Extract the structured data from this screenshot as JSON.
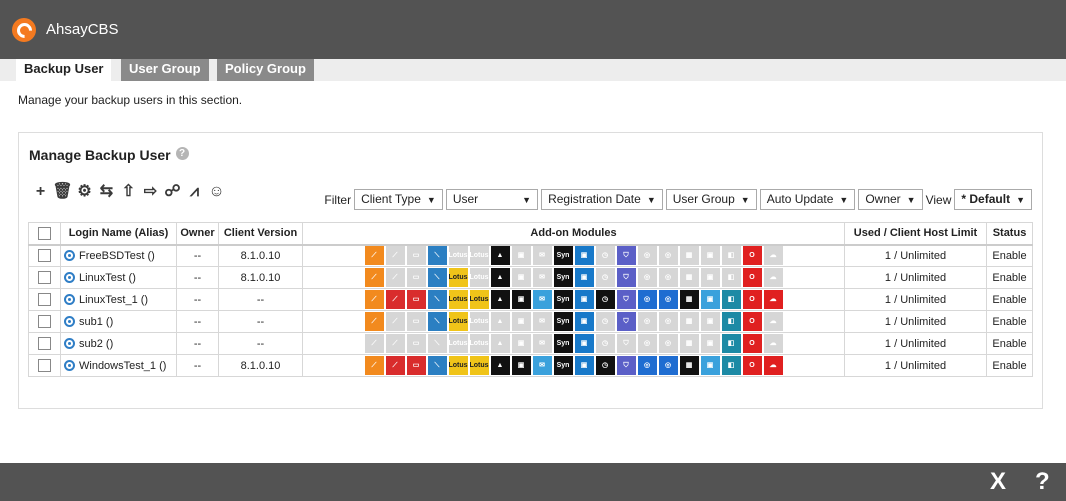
{
  "app": {
    "title": "AhsayCBS",
    "logo": "ahsay-c-logo"
  },
  "tabs": [
    {
      "label": "Backup User",
      "active": true
    },
    {
      "label": "User Group",
      "active": false
    },
    {
      "label": "Policy Group",
      "active": false
    }
  ],
  "description": "Manage your backup users in this section.",
  "panel": {
    "title": "Manage Backup User",
    "help": "?"
  },
  "toolbar": [
    {
      "icon": "add-icon",
      "glyph": "+"
    },
    {
      "icon": "delete-icon",
      "glyph": "🗑"
    },
    {
      "icon": "user-settings-icon",
      "glyph": "⚙"
    },
    {
      "icon": "merge-icon",
      "glyph": "⇆"
    },
    {
      "icon": "upload-icon",
      "glyph": "⇧"
    },
    {
      "icon": "export-icon",
      "glyph": "⇨"
    },
    {
      "icon": "user-move-icon",
      "glyph": "☍"
    },
    {
      "icon": "chart-icon",
      "glyph": "⩘"
    },
    {
      "icon": "user-search-icon",
      "glyph": "☺"
    }
  ],
  "filters": {
    "label": "Filter",
    "selects": [
      "Client Type",
      "User",
      "Registration Date",
      "User Group",
      "Auto Update",
      "Owner"
    ],
    "view_label": "View",
    "view_value": "* Default"
  },
  "columns": [
    "Login Name (Alias)",
    "Owner",
    "Client Version",
    "Add-on Modules",
    "Used / Client Host Limit",
    "Status"
  ],
  "module_icons": [
    "continuous-backup-icon",
    "cdp-icon",
    "oracle-icon",
    "mssql-icon",
    "lotus-domino-icon",
    "lotus-notes-icon",
    "google-drive-icon",
    "volume-shadow-icon",
    "exchange-mail-icon",
    "synology-nas-icon",
    "qnap-nas-icon",
    "schedule-icon",
    "shield-icon",
    "hyperv-icon",
    "vmware-icon",
    "windows-icon",
    "sharepoint-icon",
    "office365-icon",
    "office-icon",
    "cloud-icon"
  ],
  "module_colors": [
    "#f28a1e",
    "#d92c2c",
    "#d92c2c",
    "#2b7fc2",
    "#f0c419",
    "#f0c419",
    "#111111",
    "#111111",
    "#3aa1dc",
    "#111111",
    "#1879c9",
    "#111111",
    "#5b5fc7",
    "#1f6dd1",
    "#1f6dd1",
    "#111111",
    "#3aa1dc",
    "#1d8aa5",
    "#e02020",
    "#e02020"
  ],
  "module_labels": [
    "⟋",
    "⟋",
    "▭",
    "⟍",
    "Lotus",
    "Lotus",
    "▲",
    "▣",
    "✉",
    "Syn",
    "▣",
    "◷",
    "⛉",
    "◎",
    "◎",
    "▦",
    "▣",
    "◧",
    "O",
    "☁"
  ],
  "users": [
    {
      "name": "FreeBSDTest ()",
      "owner": "--",
      "version": "8.1.0.10",
      "modules": [
        1,
        0,
        0,
        1,
        0,
        0,
        1,
        0,
        0,
        1,
        1,
        0,
        1,
        0,
        0,
        0,
        0,
        0,
        1,
        0
      ],
      "limit": "1 / Unlimited",
      "status": "Enable"
    },
    {
      "name": "LinuxTest ()",
      "owner": "--",
      "version": "8.1.0.10",
      "modules": [
        1,
        0,
        0,
        1,
        1,
        0,
        1,
        0,
        0,
        1,
        1,
        0,
        1,
        0,
        0,
        0,
        0,
        0,
        1,
        0
      ],
      "limit": "1 / Unlimited",
      "status": "Enable"
    },
    {
      "name": "LinuxTest_1 ()",
      "owner": "--",
      "version": "--",
      "modules": [
        1,
        1,
        1,
        1,
        1,
        1,
        1,
        1,
        1,
        1,
        1,
        1,
        1,
        1,
        1,
        1,
        1,
        1,
        1,
        1
      ],
      "limit": "1 / Unlimited",
      "status": "Enable"
    },
    {
      "name": "sub1 ()",
      "owner": "--",
      "version": "--",
      "modules": [
        1,
        0,
        0,
        1,
        1,
        0,
        0,
        0,
        0,
        1,
        1,
        0,
        1,
        0,
        0,
        0,
        0,
        1,
        1,
        0
      ],
      "limit": "1 / Unlimited",
      "status": "Enable"
    },
    {
      "name": "sub2 ()",
      "owner": "--",
      "version": "--",
      "modules": [
        0,
        0,
        0,
        0,
        0,
        0,
        0,
        0,
        0,
        1,
        1,
        0,
        0,
        0,
        0,
        0,
        0,
        1,
        1,
        0
      ],
      "limit": "1 / Unlimited",
      "status": "Enable"
    },
    {
      "name": "WindowsTest_1 ()",
      "owner": "--",
      "version": "8.1.0.10",
      "modules": [
        1,
        1,
        1,
        1,
        1,
        1,
        1,
        1,
        1,
        1,
        1,
        1,
        1,
        1,
        1,
        1,
        1,
        1,
        1,
        1
      ],
      "limit": "1 / Unlimited",
      "status": "Enable"
    }
  ],
  "bottom": {
    "close": "X",
    "help": "?"
  }
}
